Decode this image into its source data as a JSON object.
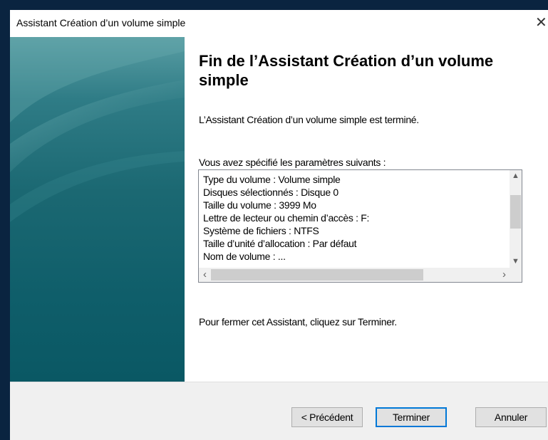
{
  "window": {
    "title": "Assistant Création d’un volume simple",
    "close_glyph": "✕"
  },
  "main": {
    "heading": "Fin de l’Assistant Création d’un volume simple",
    "intro": "L’Assistant Création d’un volume simple est terminé.",
    "params_label": "Vous avez spécifié les paramètres suivants :",
    "params": [
      "Type du volume : Volume simple",
      "Disques sélectionnés : Disque 0",
      "Taille du volume : 3999 Mo",
      "Lettre de lecteur ou chemin d’accès : F:",
      "Système de fichiers : NTFS",
      "Taille d’unité d’allocation : Par défaut",
      "Nom de volume : ..."
    ],
    "closing": "Pour fermer cet Assistant, cliquez sur Terminer."
  },
  "buttons": {
    "back": "< Précédent",
    "finish": "Terminer",
    "cancel": "Annuler"
  },
  "colors": {
    "desktop": "#0a2440",
    "sidebar": "#1b6872",
    "focus": "#0078d7"
  }
}
